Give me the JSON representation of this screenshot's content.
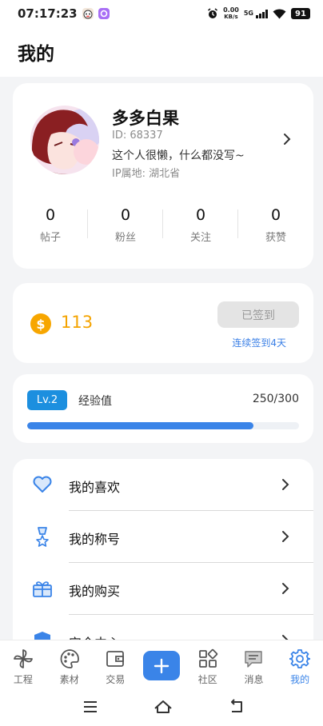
{
  "status_bar": {
    "time": "07:17:23",
    "net_speed_value": "0.00",
    "net_speed_unit": "KB/s",
    "network": "5G",
    "battery": "91"
  },
  "header": {
    "title": "我的"
  },
  "profile": {
    "name": "多多白果",
    "id": "ID: 68337",
    "bio": "这个人很懒，什么都没写~",
    "ip_location": "IP属地: 湖北省",
    "stats": [
      {
        "value": "0",
        "label": "帖子"
      },
      {
        "value": "0",
        "label": "粉丝"
      },
      {
        "value": "0",
        "label": "关注"
      },
      {
        "value": "0",
        "label": "获赞"
      }
    ]
  },
  "coins": {
    "symbol": "$",
    "amount": "113",
    "sign_button": "已签到",
    "streak": "连续签到4天"
  },
  "level": {
    "badge": "Lv.2",
    "label": "经验值",
    "value": "250/300",
    "progress_fraction": 0.833
  },
  "menu": {
    "items": [
      {
        "label": "我的喜欢",
        "icon": "heart-icon"
      },
      {
        "label": "我的称号",
        "icon": "medal-icon"
      },
      {
        "label": "我的购买",
        "icon": "gift-box-icon"
      },
      {
        "label": "安全中心",
        "icon": "shield-icon"
      }
    ]
  },
  "tabbar": {
    "items": [
      {
        "label": "工程",
        "icon": "pinwheel-icon"
      },
      {
        "label": "素材",
        "icon": "palette-icon"
      },
      {
        "label": "交易",
        "icon": "wallet-icon"
      },
      {
        "label": "",
        "icon": "plus-icon"
      },
      {
        "label": "社区",
        "icon": "grid-icon"
      },
      {
        "label": "消息",
        "icon": "message-icon"
      },
      {
        "label": "我的",
        "icon": "gear-icon"
      }
    ],
    "active_index": 6
  },
  "colors": {
    "accent": "#3a84e8",
    "coin": "#f4a300",
    "level_badge": "#1c8fdf",
    "background": "#f3f4f6"
  }
}
